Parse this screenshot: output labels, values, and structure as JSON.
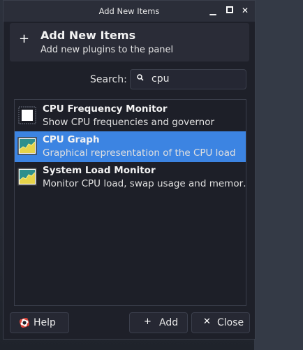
{
  "window": {
    "title": "Add New Items",
    "buttons": {
      "minimize": "▁",
      "maximize": "▢",
      "close": "✕"
    }
  },
  "header": {
    "icon": "plus-icon",
    "title": "Add New Items",
    "subtitle": "Add new plugins to the panel"
  },
  "search": {
    "label": "Search:",
    "value": "cpu",
    "icon": "search-icon"
  },
  "plugins": [
    {
      "title": "CPU Frequency Monitor",
      "description": "Show CPU frequencies and governor",
      "icon": "cpu-frequency-icon",
      "selected": false
    },
    {
      "title": "CPU Graph",
      "description": "Graphical representation of the CPU load",
      "icon": "graph-icon",
      "selected": true
    },
    {
      "title": "System Load Monitor",
      "description": "Monitor CPU load, swap usage and memor…",
      "icon": "graph-icon",
      "selected": false
    }
  ],
  "footer": {
    "help_label": "Help",
    "add_label": "Add",
    "close_label": "Close"
  },
  "colors": {
    "selection": "#3c84e2",
    "dialog_bg": "#1e2029",
    "text": "#e8e8e8"
  }
}
